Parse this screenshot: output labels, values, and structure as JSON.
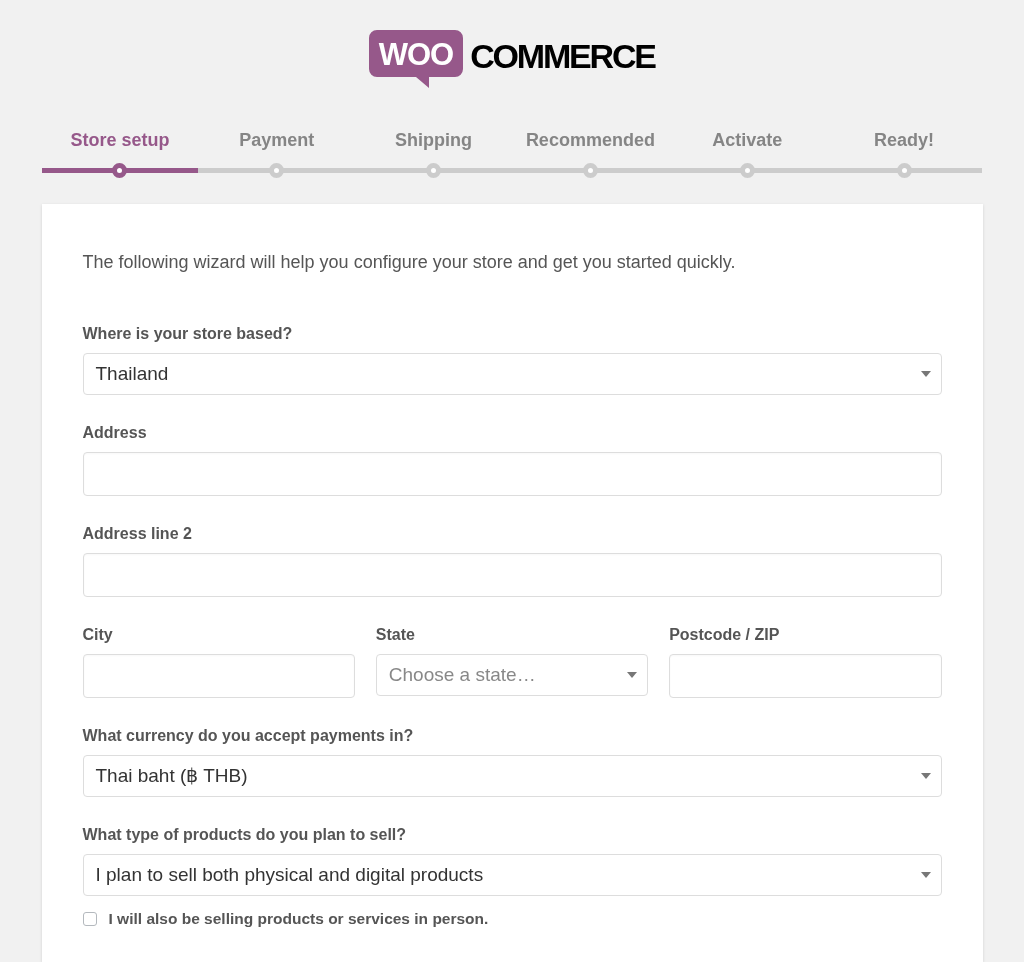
{
  "logo": {
    "mark": "WOO",
    "wordmark": "COMMERCE"
  },
  "steps": [
    {
      "label": "Store setup",
      "selected": true
    },
    {
      "label": "Payment",
      "selected": false
    },
    {
      "label": "Shipping",
      "selected": false
    },
    {
      "label": "Recommended",
      "selected": false
    },
    {
      "label": "Activate",
      "selected": false
    },
    {
      "label": "Ready!",
      "selected": false
    }
  ],
  "form": {
    "intro": "The following wizard will help you configure your store and get you started quickly.",
    "rows": [
      {
        "fields": [
          {
            "kind": "select",
            "label": "Where is your store based?",
            "value": "Thailand"
          }
        ]
      },
      {
        "fields": [
          {
            "kind": "text",
            "label": "Address"
          }
        ]
      },
      {
        "fields": [
          {
            "kind": "text",
            "label": "Address line 2"
          }
        ]
      },
      {
        "fields": [
          {
            "kind": "text",
            "label": "City"
          },
          {
            "kind": "select",
            "label": "State",
            "placeholder": "Choose a state…"
          },
          {
            "kind": "text",
            "label": "Postcode / ZIP"
          }
        ]
      },
      {
        "fields": [
          {
            "kind": "select",
            "label": "What currency do you accept payments in?",
            "value": "Thai baht (฿ THB)"
          }
        ]
      },
      {
        "fields": [
          {
            "kind": "select",
            "label": "What type of products do you plan to sell?",
            "value": "I plan to sell both physical and digital products"
          }
        ]
      }
    ],
    "checkbox": {
      "label": "I will also be selling products or services in person.",
      "checked": false
    }
  }
}
